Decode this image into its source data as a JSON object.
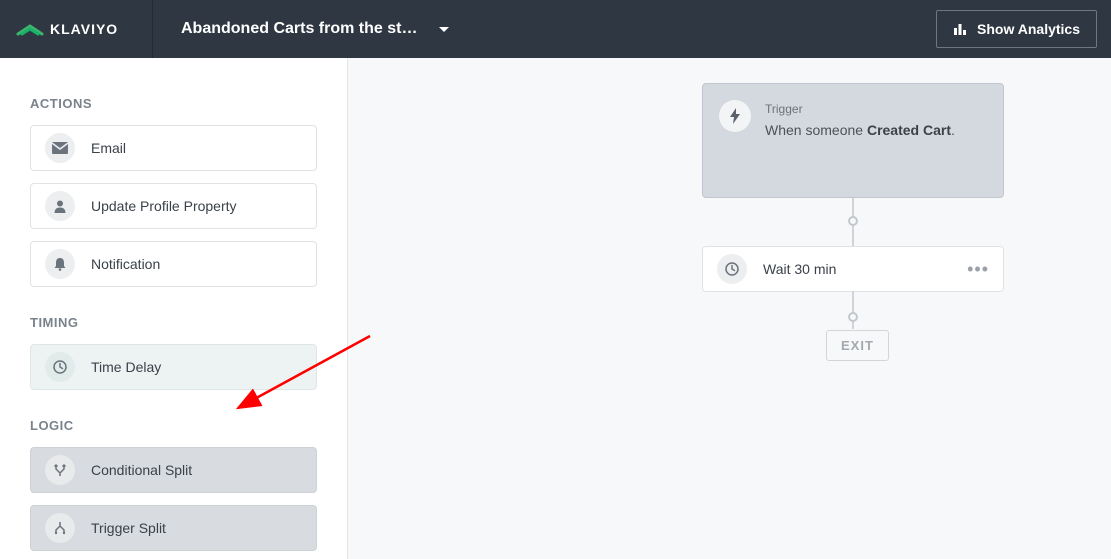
{
  "header": {
    "brand": "KLAVIYO",
    "flow_name": "Abandoned Carts from the st…",
    "analytics_label": "Show Analytics"
  },
  "sidebar": {
    "sections": {
      "actions": {
        "title": "ACTIONS",
        "items": {
          "email": "Email",
          "update_profile": "Update Profile Property",
          "notification": "Notification"
        }
      },
      "timing": {
        "title": "TIMING",
        "items": {
          "time_delay": "Time Delay"
        }
      },
      "logic": {
        "title": "LOGIC",
        "items": {
          "conditional_split": "Conditional Split",
          "trigger_split": "Trigger Split"
        }
      }
    }
  },
  "canvas": {
    "trigger": {
      "title": "Trigger",
      "prefix": "When someone ",
      "bold": "Created Cart",
      "suffix": "."
    },
    "wait": {
      "label": "Wait 30 min"
    },
    "exit": {
      "label": "EXIT"
    }
  }
}
